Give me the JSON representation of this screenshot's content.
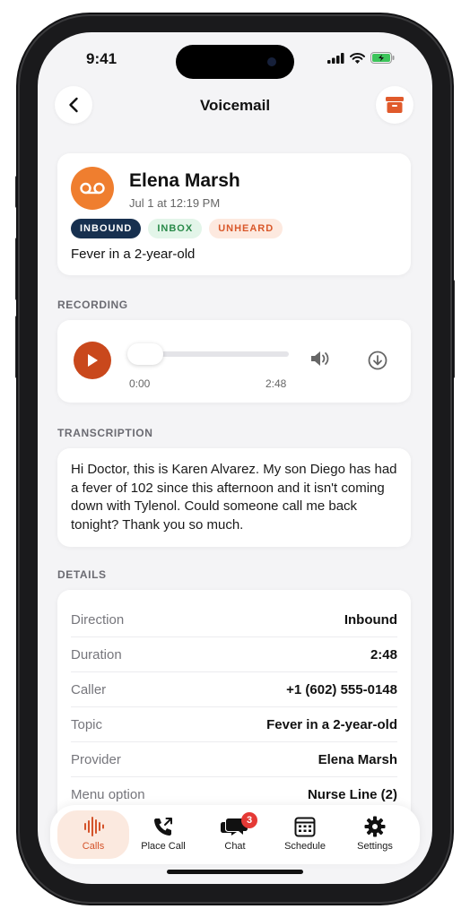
{
  "status_bar": {
    "time": "9:41"
  },
  "nav": {
    "title": "Voicemail"
  },
  "voicemail": {
    "caller_name": "Elena Marsh",
    "timestamp": "Jul 1 at 12:19 PM",
    "badges": [
      "INBOUND",
      "INBOX",
      "UNHEARD"
    ],
    "topic": "Fever in a 2-year-old"
  },
  "sections": {
    "recording": "RECORDING",
    "transcription": "TRANSCRIPTION",
    "details": "DETAILS"
  },
  "recording": {
    "elapsed": "0:00",
    "duration": "2:48",
    "progress": 0
  },
  "transcription": "Hi Doctor, this is Karen Alvarez. My son Diego has had a fever of 102 since this afternoon and it isn't coming down with Tylenol. Could someone call me back tonight? Thank you so much.",
  "details": [
    {
      "label": "Direction",
      "value": "Inbound"
    },
    {
      "label": "Duration",
      "value": "2:48"
    },
    {
      "label": "Caller",
      "value": "+1 (602) 555-0148"
    },
    {
      "label": "Topic",
      "value": "Fever in a 2-year-old"
    },
    {
      "label": "Provider",
      "value": "Elena Marsh"
    },
    {
      "label": "Menu option",
      "value": "Nurse Line (2)"
    }
  ],
  "tabs": [
    {
      "label": "Calls",
      "icon": "sound-wave-icon",
      "active": true
    },
    {
      "label": "Place Call",
      "icon": "phone-outgoing-icon",
      "active": false
    },
    {
      "label": "Chat",
      "icon": "chat-bubbles-icon",
      "active": false,
      "badge": "3"
    },
    {
      "label": "Schedule",
      "icon": "calendar-icon",
      "active": false
    },
    {
      "label": "Settings",
      "icon": "gear-icon",
      "active": false
    }
  ],
  "colors": {
    "accent": "#ef7e2f",
    "play": "#c9481c",
    "inbound_badge": "#17304f",
    "inbox_badge": "#2a8a4a",
    "unheard_badge": "#d9582a",
    "chat_badge": "#e53935"
  }
}
